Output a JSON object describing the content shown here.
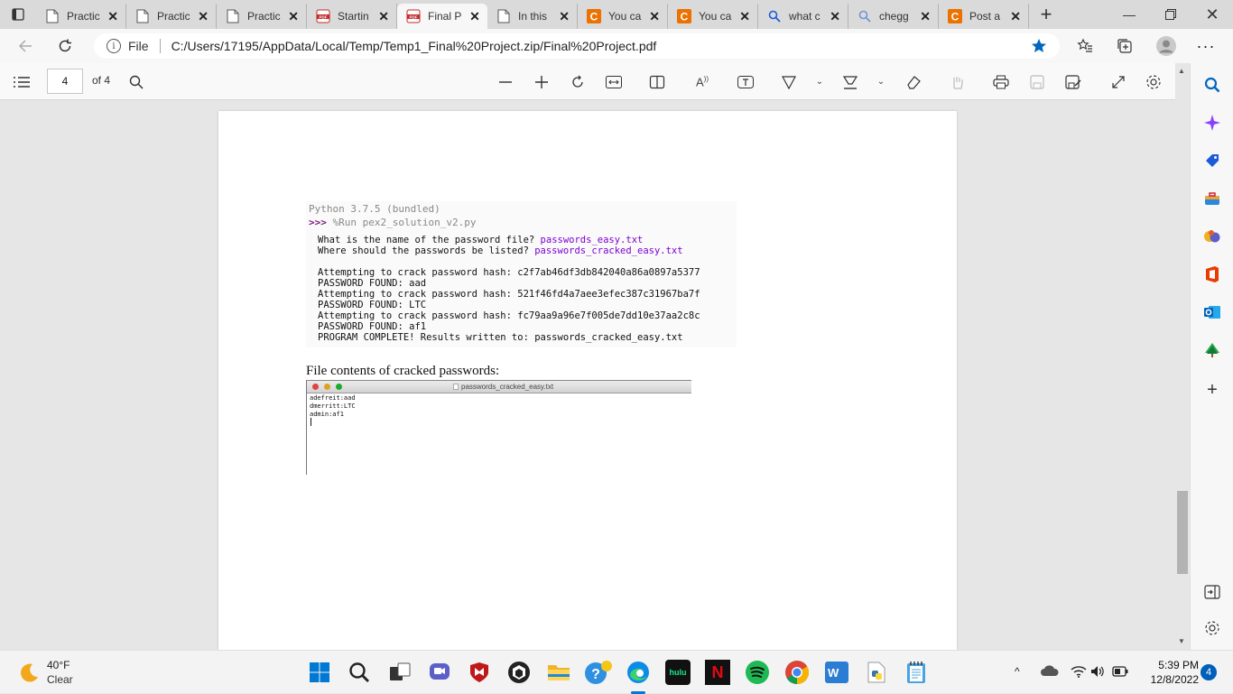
{
  "tabs": [
    {
      "title": "Practic",
      "icon": "document-icon"
    },
    {
      "title": "Practic",
      "icon": "document-icon"
    },
    {
      "title": "Practic",
      "icon": "document-icon"
    },
    {
      "title": "Startin",
      "icon": "pdf-icon"
    },
    {
      "title": "Final P",
      "icon": "pdf-icon",
      "active": true
    },
    {
      "title": "In this",
      "icon": "document-icon"
    },
    {
      "title": "You ca",
      "icon": "chegg-icon"
    },
    {
      "title": "You ca",
      "icon": "chegg-icon"
    },
    {
      "title": "what c",
      "icon": "search-icon"
    },
    {
      "title": "chegg",
      "icon": "search-icon"
    },
    {
      "title": "Post a",
      "icon": "chegg-icon"
    }
  ],
  "address": {
    "file_label": "File",
    "url": "C:/Users/17195/AppData/Local/Temp/Temp1_Final%20Project.zip/Final%20Project.pdf"
  },
  "pdf_toolbar": {
    "page_number": "4",
    "page_count": "of 4"
  },
  "document": {
    "python_version": "Python 3.7.5 (bundled)",
    "prompt": ">>>",
    "run_cmd": "%Run pex2_solution_v2.py",
    "q1_text": "What is the name of the password file? ",
    "q1_answer": "passwords_easy.txt",
    "q2_text": "Where should the passwords be listed? ",
    "q2_answer": "passwords_cracked_easy.txt",
    "output": [
      "Attempting to crack password hash: c2f7ab46df3db842040a86a0897a5377",
      "PASSWORD FOUND: aad",
      "Attempting to crack password hash: 521f46fd4a7aee3efec387c31967ba7f",
      "PASSWORD FOUND: LTC",
      "Attempting to crack password hash: fc79aa9a96e7f005de7dd10e37aa2c8c",
      "PASSWORD FOUND: af1",
      "PROGRAM COMPLETE! Results written to: passwords_cracked_easy.txt"
    ],
    "file_contents_label": "File contents of cracked passwords:",
    "editor_title": "passwords_cracked_easy.txt",
    "editor_lines": [
      "adefreit:aad",
      "dmerritt:LTC",
      "admin:af1"
    ]
  },
  "taskbar": {
    "temperature": "40°F",
    "condition": "Clear",
    "time": "5:39 PM",
    "date": "12/8/2022",
    "notifications": "4",
    "hulu_label": "hulu",
    "netflix_label": "N",
    "word_label": "W"
  },
  "colors": {
    "accent": "#005fb8",
    "chegg": "#eb7100",
    "prompt_purple": "#7b00d4"
  }
}
